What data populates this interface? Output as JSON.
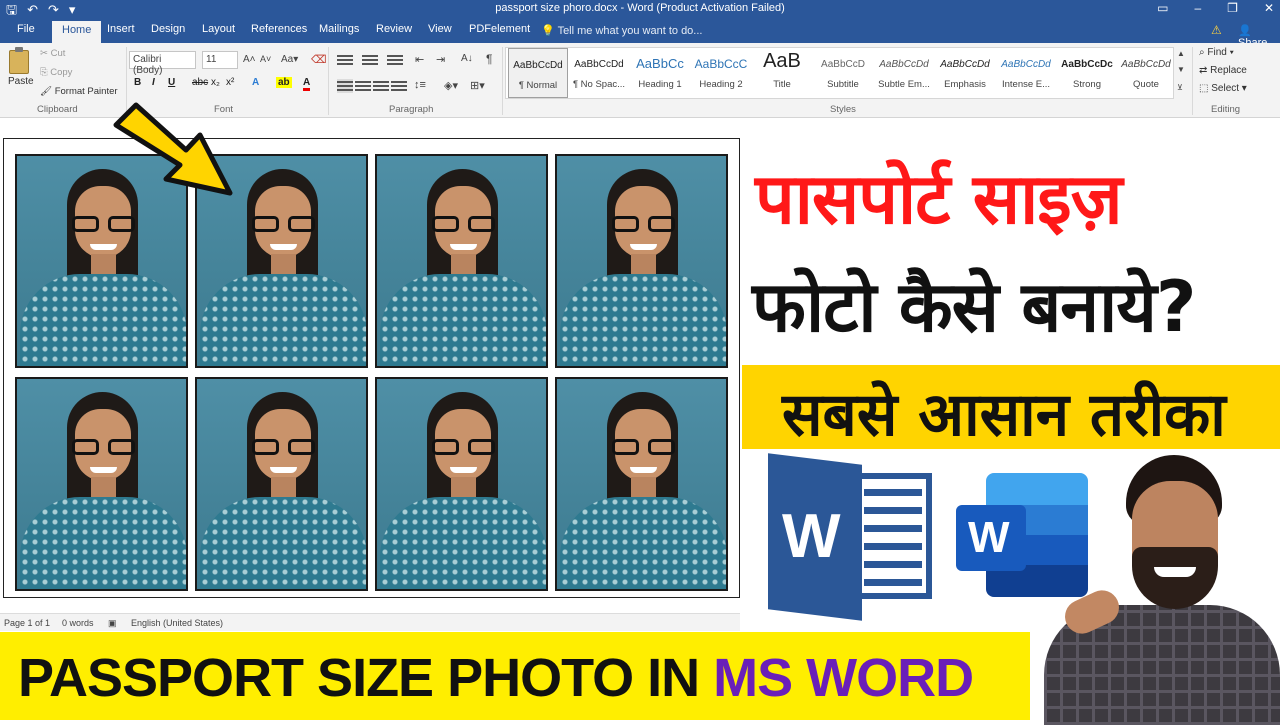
{
  "titlebar": {
    "title": "passport size phoro.docx - Word (Product Activation Failed)"
  },
  "tabs": [
    "File",
    "Home",
    "Insert",
    "Design",
    "Layout",
    "References",
    "Mailings",
    "Review",
    "View",
    "PDFelement"
  ],
  "tell_me": "Tell me what you want to do...",
  "share": "Share",
  "clipboard": {
    "paste": "Paste",
    "cut": "Cut",
    "copy": "Copy",
    "format_painter": "Format Painter",
    "label": "Clipboard"
  },
  "font": {
    "name": "Calibri (Body)",
    "size": "11",
    "label": "Font"
  },
  "paragraph": {
    "label": "Paragraph"
  },
  "styles": {
    "label": "Styles",
    "items": [
      {
        "sample": "AaBbCcDd",
        "name": "¶ Normal"
      },
      {
        "sample": "AaBbCcDd",
        "name": "¶ No Spac..."
      },
      {
        "sample": "AaBbCc",
        "name": "Heading 1"
      },
      {
        "sample": "AaBbCcC",
        "name": "Heading 2"
      },
      {
        "sample": "AaB",
        "name": "Title"
      },
      {
        "sample": "AaBbCcD",
        "name": "Subtitle"
      },
      {
        "sample": "AaBbCcDd",
        "name": "Subtle Em..."
      },
      {
        "sample": "AaBbCcDd",
        "name": "Emphasis"
      },
      {
        "sample": "AaBbCcDd",
        "name": "Intense E..."
      },
      {
        "sample": "AaBbCcDc",
        "name": "Strong"
      },
      {
        "sample": "AaBbCcDd",
        "name": "Quote"
      }
    ]
  },
  "editing": {
    "find": "Find",
    "replace": "Replace",
    "select": "Select",
    "label": "Editing"
  },
  "statusbar": {
    "page": "Page 1 of 1",
    "words": "0 words",
    "language": "English (United States)"
  },
  "thumbnail": {
    "hindi_line1": "पासपोर्ट साइज़",
    "hindi_line2": "फोटो कैसे बनाये?",
    "hindi_line3": "सबसे आसान तरीका",
    "banner_main": "PASSPORT SIZE PHOTO IN ",
    "banner_ms": "MS WORD"
  },
  "colors": {
    "word_blue": "#2b579a",
    "banner_yellow": "#ffee00",
    "band_yellow": "#ffd400",
    "hindi_red": "#ff1818",
    "ms_purple": "#6a1fb8"
  }
}
